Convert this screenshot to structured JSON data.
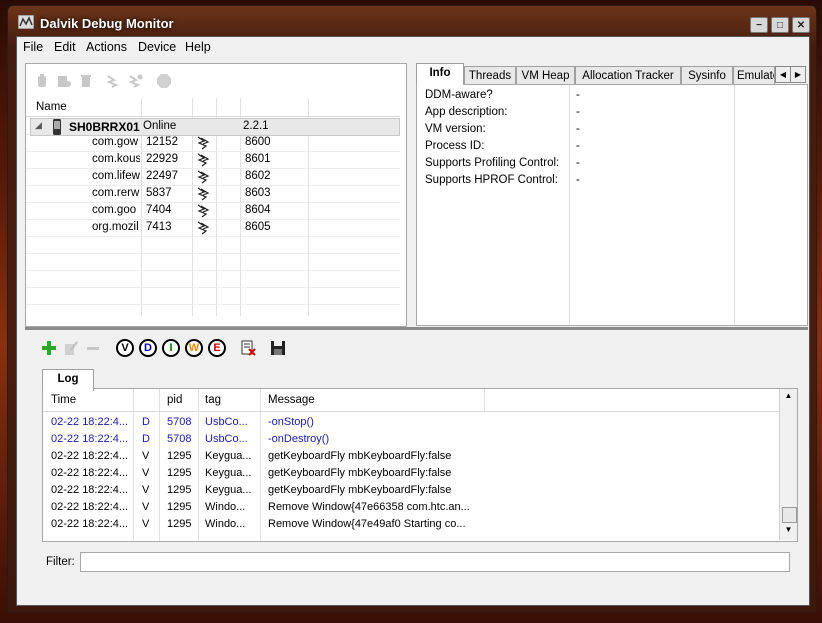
{
  "window": {
    "title": "Dalvik Debug Monitor",
    "minimize": "−",
    "maximize": "□",
    "close": "✕"
  },
  "menu": [
    "File",
    "Edit",
    "Actions",
    "Device",
    "Help"
  ],
  "devices": {
    "header_name": "Name",
    "device": {
      "name": "SH0BRRX01",
      "status": "Online",
      "version": "2.2.1"
    },
    "processes": [
      {
        "name": "com.gow",
        "pid": "12152",
        "port": "8600"
      },
      {
        "name": "com.kous",
        "pid": "22929",
        "port": "8601"
      },
      {
        "name": "com.lifew",
        "pid": "22497",
        "port": "8602"
      },
      {
        "name": "com.rerw",
        "pid": "5837",
        "port": "8603"
      },
      {
        "name": "com.goo",
        "pid": "7404",
        "port": "8604"
      },
      {
        "name": "org.mozil",
        "pid": "7413",
        "port": "8605"
      }
    ]
  },
  "tabs": [
    "Info",
    "Threads",
    "VM Heap",
    "Allocation Tracker",
    "Sysinfo",
    "Emulatc"
  ],
  "info": [
    {
      "label": "DDM-aware?",
      "value": "-"
    },
    {
      "label": "App description:",
      "value": "-"
    },
    {
      "label": "VM version:",
      "value": "-"
    },
    {
      "label": "Process ID:",
      "value": "-"
    },
    {
      "label": "Supports Profiling Control:",
      "value": "-"
    },
    {
      "label": "Supports HPROF Control:",
      "value": "-"
    }
  ],
  "log_levels": [
    "V",
    "D",
    "I",
    "W",
    "E"
  ],
  "log_level_colors": {
    "V": "#000000",
    "D": "#0000cc",
    "I": "#007700",
    "W": "#ff8800",
    "E": "#cc0000"
  },
  "log": {
    "tab": "Log",
    "headers": {
      "time": "Time",
      "pid": "pid",
      "tag": "tag",
      "message": "Message"
    },
    "rows": [
      {
        "time": "02-22 18:22:4...",
        "level": "D",
        "pid": "5708",
        "tag": "UsbCo...",
        "message": "-onStop()",
        "color": "#1a1aa8"
      },
      {
        "time": "02-22 18:22:4...",
        "level": "D",
        "pid": "5708",
        "tag": "UsbCo...",
        "message": "-onDestroy()",
        "color": "#1a1aa8"
      },
      {
        "time": "02-22 18:22:4...",
        "level": "V",
        "pid": "1295",
        "tag": "Keygua...",
        "message": "getKeyboardFly mbKeyboardFly:false",
        "color": "#000000"
      },
      {
        "time": "02-22 18:22:4...",
        "level": "V",
        "pid": "1295",
        "tag": "Keygua...",
        "message": "getKeyboardFly mbKeyboardFly:false",
        "color": "#000000"
      },
      {
        "time": "02-22 18:22:4...",
        "level": "V",
        "pid": "1295",
        "tag": "Keygua...",
        "message": "getKeyboardFly mbKeyboardFly:false",
        "color": "#000000"
      },
      {
        "time": "02-22 18:22:4...",
        "level": "V",
        "pid": "1295",
        "tag": "Windo...",
        "message": "Remove Window{47e66358 com.htc.an...",
        "color": "#000000"
      },
      {
        "time": "02-22 18:22:4...",
        "level": "V",
        "pid": "1295",
        "tag": "Windo...",
        "message": "Remove Window{47e49af0 Starting co...",
        "color": "#000000"
      }
    ]
  },
  "filter": {
    "label": "Filter:",
    "value": ""
  }
}
